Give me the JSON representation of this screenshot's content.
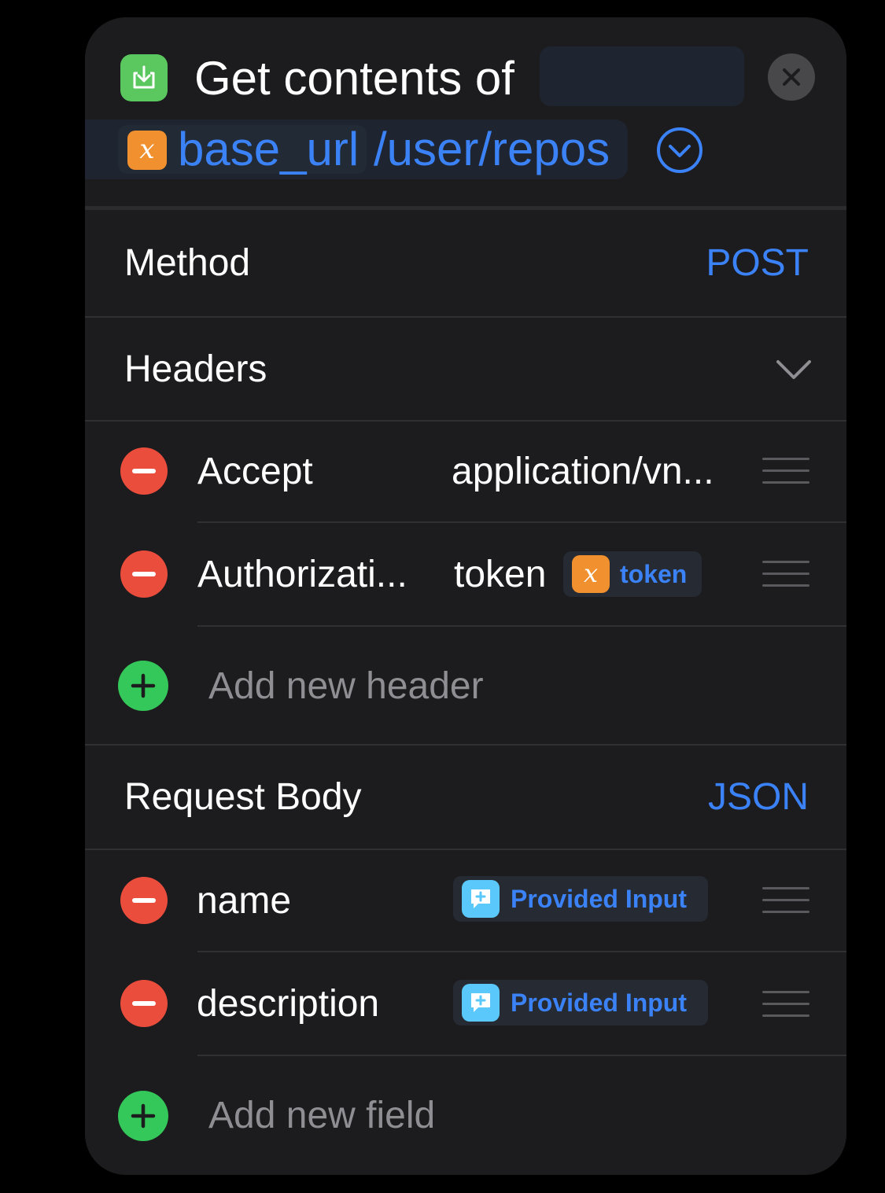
{
  "action": {
    "title": "Get contents of",
    "url_variable": "base_url",
    "url_path": "/user/repos",
    "variable_icon": "x"
  },
  "method": {
    "label": "Method",
    "value": "POST"
  },
  "headers": {
    "label": "Headers",
    "items": [
      {
        "key": "Accept",
        "value": "application/vn..."
      },
      {
        "key": "Authorizati...",
        "value": "token",
        "variable": "token",
        "variable_icon": "x"
      }
    ],
    "add_label": "Add new header"
  },
  "request_body": {
    "label": "Request Body",
    "value": "JSON",
    "fields": [
      {
        "key": "name",
        "value": "Provided Input"
      },
      {
        "key": "description",
        "value": "Provided Input"
      }
    ],
    "add_label": "Add new field"
  },
  "colors": {
    "accent": "#3b82f6",
    "remove": "#eb4d3d",
    "add": "#34c759",
    "variable": "#f0902e",
    "app_icon": "#5ac85f",
    "provided_input_icon": "#5ac8fa"
  },
  "icons": [
    "download-icon",
    "close-icon",
    "chevron-down-circle-icon",
    "chevron-down-icon",
    "minus-icon",
    "plus-icon",
    "drag-handle-icon",
    "variable-icon",
    "provided-input-icon"
  ]
}
